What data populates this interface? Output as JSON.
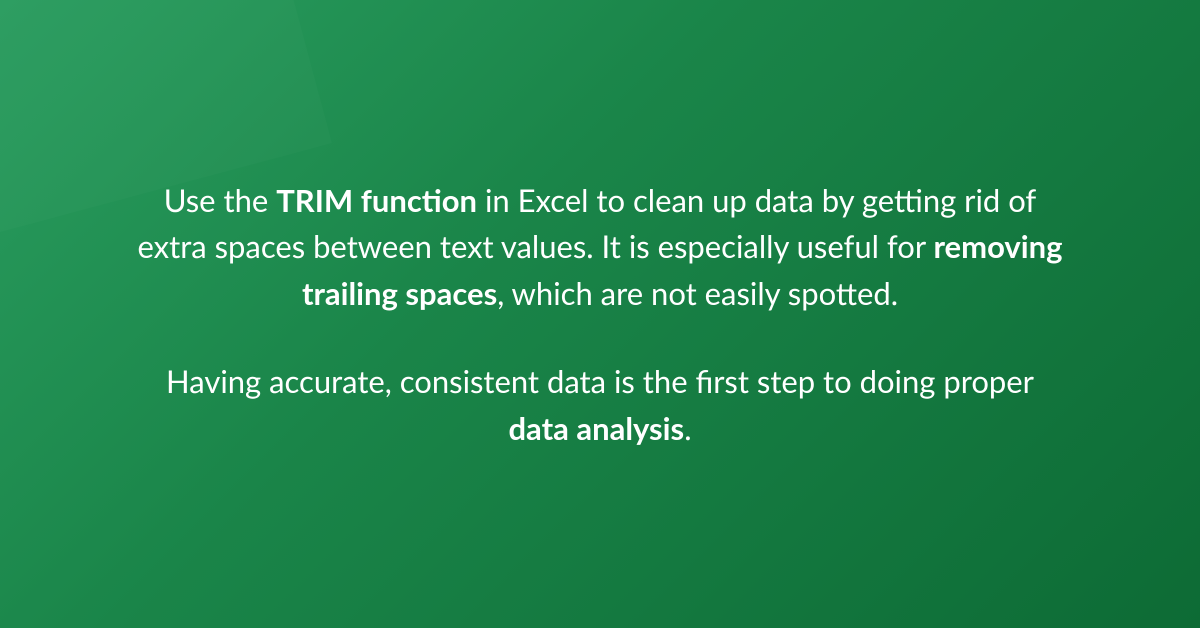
{
  "paragraph1": {
    "part1": "Use the ",
    "bold1": "TRIM function",
    "part2": " in Excel to clean up data by getting rid of extra spaces between text values. It is especially useful for ",
    "bold2": "removing trailing spaces",
    "part3": ", which are not easily spotted."
  },
  "paragraph2": {
    "part1": "Having accurate, consistent data is the first step to doing proper ",
    "bold1": "data analysis",
    "part2": "."
  }
}
